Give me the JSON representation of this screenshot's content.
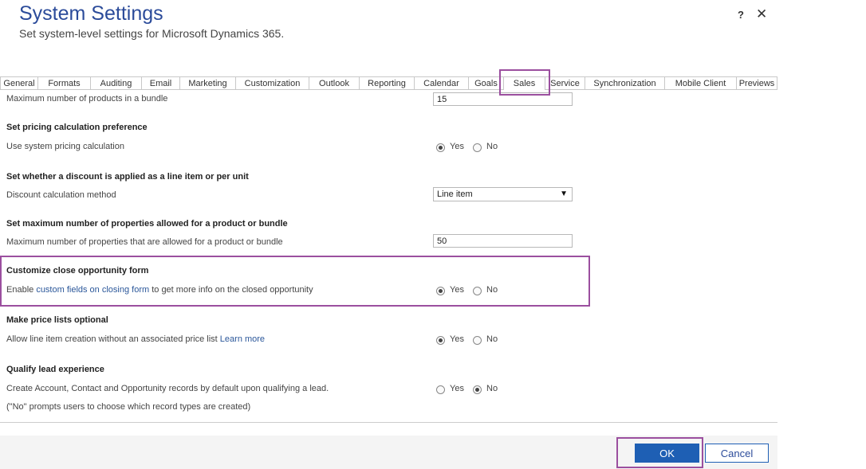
{
  "header": {
    "title": "System Settings",
    "subtitle": "Set system-level settings for Microsoft Dynamics 365.",
    "help": "?",
    "close": "✕"
  },
  "tabs": [
    {
      "label": "General"
    },
    {
      "label": "Formats"
    },
    {
      "label": "Auditing"
    },
    {
      "label": "Email"
    },
    {
      "label": "Marketing"
    },
    {
      "label": "Customization"
    },
    {
      "label": "Outlook"
    },
    {
      "label": "Reporting"
    },
    {
      "label": "Calendar"
    },
    {
      "label": "Goals"
    },
    {
      "label": "Sales",
      "active": true
    },
    {
      "label": "Service"
    },
    {
      "label": "Synchronization"
    },
    {
      "label": "Mobile Client"
    },
    {
      "label": "Previews"
    }
  ],
  "settings": {
    "bundle_products": {
      "label": "Maximum number of products in a bundle",
      "value": "15"
    },
    "pricing": {
      "title": "Set pricing calculation preference",
      "label": "Use system pricing calculation",
      "yes": "Yes",
      "no": "No",
      "selected": "Yes"
    },
    "discount": {
      "title": "Set whether a discount is applied as a line item or per unit",
      "label": "Discount calculation method",
      "value": "Line item"
    },
    "properties": {
      "title": "Set maximum number of properties allowed for a product or bundle",
      "label": "Maximum number of properties that are allowed for a product or bundle",
      "value": "50"
    },
    "close_opportunity": {
      "title": "Customize close opportunity form",
      "label_pre": "Enable ",
      "label_link": "custom fields on closing form",
      "label_post": " to get more info on the closed opportunity",
      "yes": "Yes",
      "no": "No",
      "selected": "Yes"
    },
    "price_lists": {
      "title": "Make price lists optional",
      "label_pre": "Allow line item creation without an associated price list ",
      "label_link": "Learn more",
      "yes": "Yes",
      "no": "No",
      "selected": "Yes"
    },
    "qualify_lead": {
      "title": "Qualify lead experience",
      "label": "Create Account, Contact and Opportunity records by default upon qualifying a lead.",
      "note": "(\"No\" prompts users to choose which record types are created)",
      "yes": "Yes",
      "no": "No",
      "selected": "No"
    }
  },
  "footer": {
    "ok": "OK",
    "cancel": "Cancel"
  },
  "colors": {
    "title": "#2b4b9a",
    "highlight": "#9b4f9f",
    "ok_button": "#1e5fb4",
    "link": "#2b579a"
  }
}
